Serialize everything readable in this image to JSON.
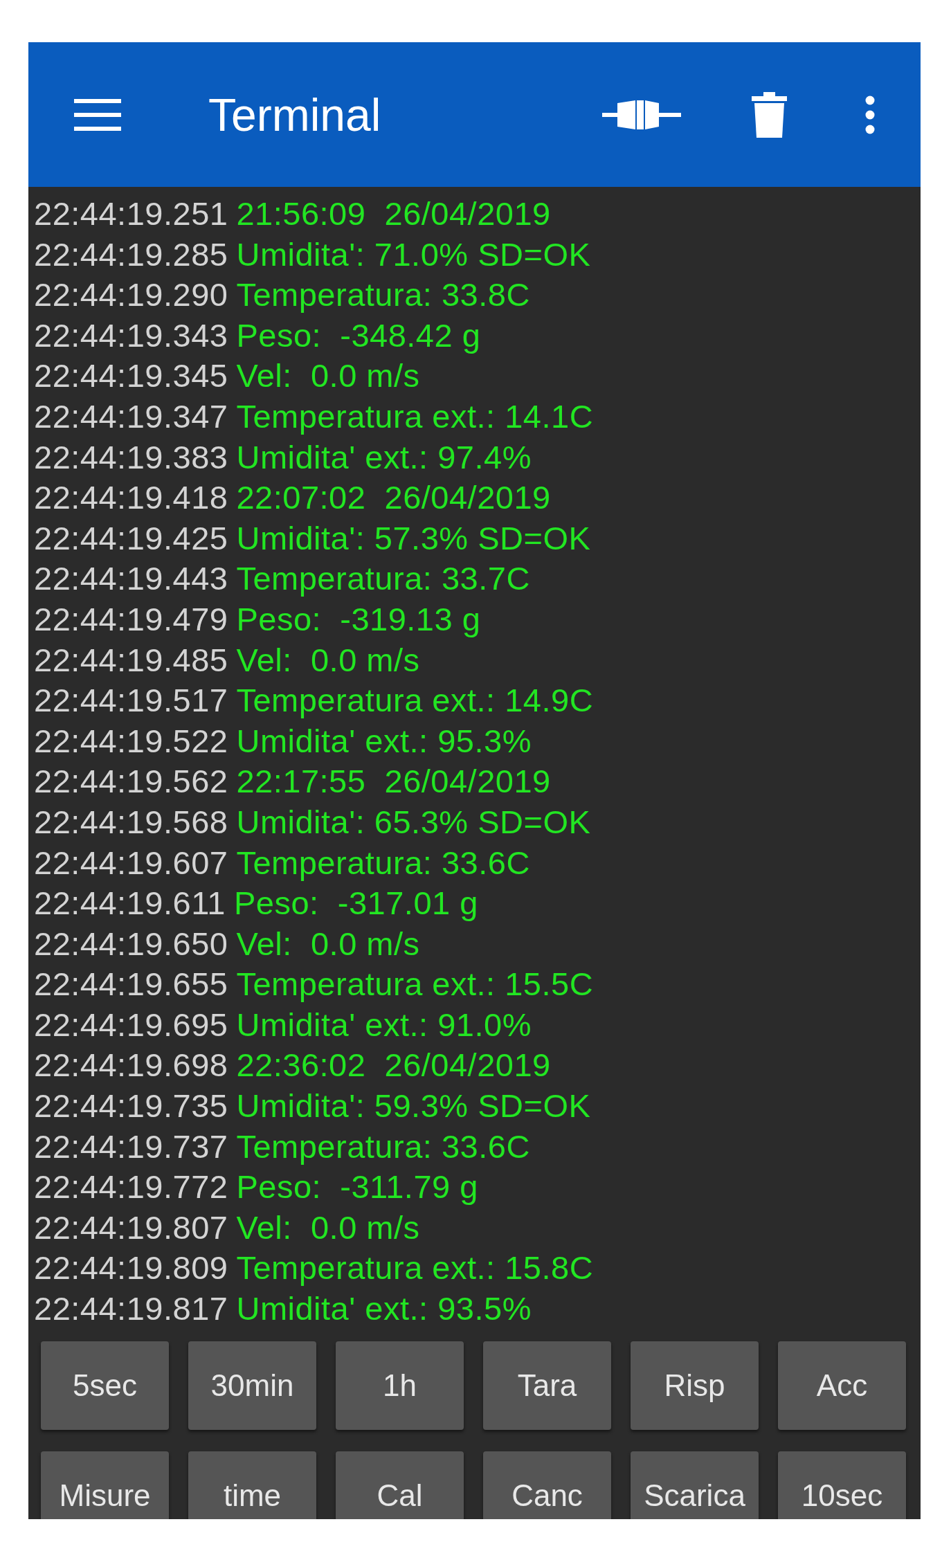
{
  "app_bar": {
    "title": "Terminal"
  },
  "lines": [
    {
      "time": "22:44:19.251",
      "text": "21:56:09  26/04/2019"
    },
    {
      "time": "22:44:19.285",
      "text": "Umidita': 71.0% SD=OK"
    },
    {
      "time": "22:44:19.290",
      "text": "Temperatura: 33.8C"
    },
    {
      "time": "22:44:19.343",
      "text": "Peso:  -348.42 g"
    },
    {
      "time": "22:44:19.345",
      "text": "Vel:  0.0 m/s"
    },
    {
      "time": "22:44:19.347",
      "text": "Temperatura ext.: 14.1C"
    },
    {
      "time": "22:44:19.383",
      "text": "Umidita' ext.: 97.4%"
    },
    {
      "time": "22:44:19.418",
      "text": "22:07:02  26/04/2019"
    },
    {
      "time": "22:44:19.425",
      "text": "Umidita': 57.3% SD=OK"
    },
    {
      "time": "22:44:19.443",
      "text": "Temperatura: 33.7C"
    },
    {
      "time": "22:44:19.479",
      "text": "Peso:  -319.13 g"
    },
    {
      "time": "22:44:19.485",
      "text": "Vel:  0.0 m/s"
    },
    {
      "time": "22:44:19.517",
      "text": "Temperatura ext.: 14.9C"
    },
    {
      "time": "22:44:19.522",
      "text": "Umidita' ext.: 95.3%"
    },
    {
      "time": "22:44:19.562",
      "text": "22:17:55  26/04/2019"
    },
    {
      "time": "22:44:19.568",
      "text": "Umidita': 65.3% SD=OK"
    },
    {
      "time": "22:44:19.607",
      "text": "Temperatura: 33.6C"
    },
    {
      "time": "22:44:19.611",
      "text": "Peso:  -317.01 g"
    },
    {
      "time": "22:44:19.650",
      "text": "Vel:  0.0 m/s"
    },
    {
      "time": "22:44:19.655",
      "text": "Temperatura ext.: 15.5C"
    },
    {
      "time": "22:44:19.695",
      "text": "Umidita' ext.: 91.0%"
    },
    {
      "time": "22:44:19.698",
      "text": "22:36:02  26/04/2019"
    },
    {
      "time": "22:44:19.735",
      "text": "Umidita': 59.3% SD=OK"
    },
    {
      "time": "22:44:19.737",
      "text": "Temperatura: 33.6C"
    },
    {
      "time": "22:44:19.772",
      "text": "Peso:  -311.79 g"
    },
    {
      "time": "22:44:19.807",
      "text": "Vel:  0.0 m/s"
    },
    {
      "time": "22:44:19.809",
      "text": "Temperatura ext.: 15.8C"
    },
    {
      "time": "22:44:19.817",
      "text": "Umidita' ext.: 93.5%"
    }
  ],
  "buttons": [
    "5sec",
    "30min",
    "1h",
    "Tara",
    "Risp",
    "Acc",
    "Misure",
    "time",
    "Cal",
    "Canc",
    "Scarica",
    "10sec"
  ]
}
